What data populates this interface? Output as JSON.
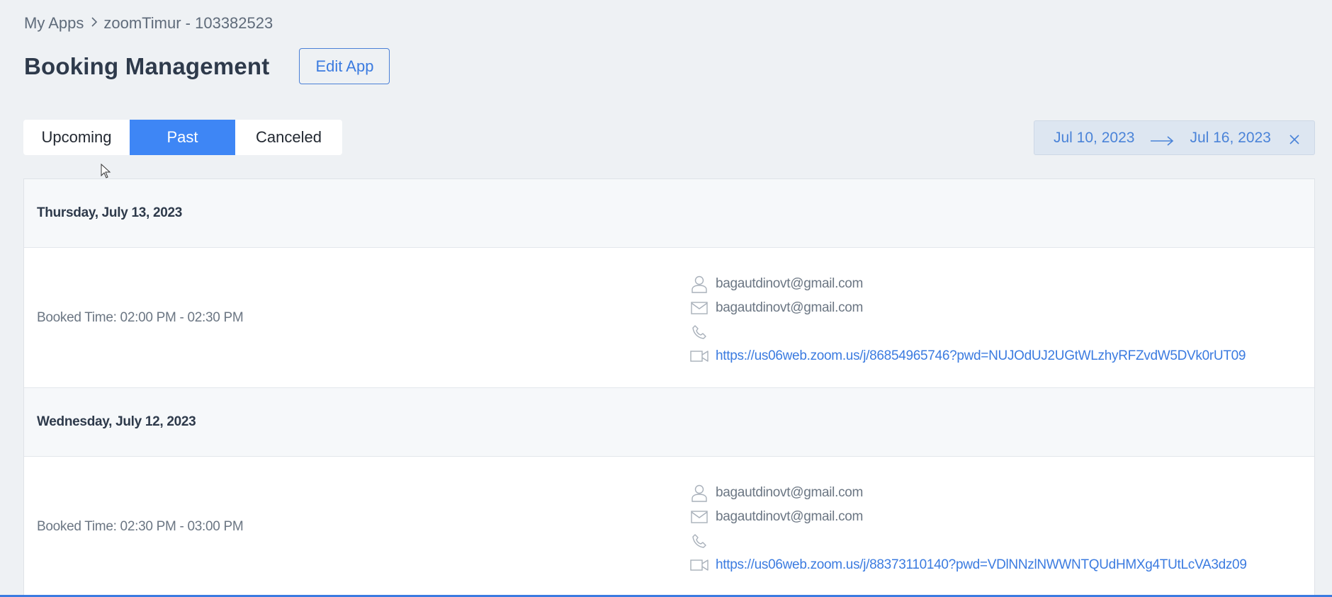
{
  "breadcrumb": {
    "root": "My Apps",
    "current": "zoomTimur - 103382523"
  },
  "header": {
    "title": "Booking Management",
    "edit_label": "Edit App"
  },
  "tabs": [
    {
      "label": "Upcoming",
      "active": false
    },
    {
      "label": "Past",
      "active": true
    },
    {
      "label": "Canceled",
      "active": false
    }
  ],
  "date_range": {
    "from": "Jul 10, 2023",
    "to": "Jul 16, 2023"
  },
  "days": [
    {
      "date": "Thursday, July 13, 2023",
      "booking": {
        "time": "Booked Time: 02:00 PM - 02:30 PM",
        "name": "bagautdinovt@gmail.com",
        "email": "bagautdinovt@gmail.com",
        "phone": "",
        "meeting_url": "https://us06web.zoom.us/j/86854965746?pwd=NUJOdUJ2UGtWLzhyRFZvdW5DVk0rUT09"
      }
    },
    {
      "date": "Wednesday, July 12, 2023",
      "booking": {
        "time": "Booked Time: 02:30 PM - 03:00 PM",
        "name": "bagautdinovt@gmail.com",
        "email": "bagautdinovt@gmail.com",
        "phone": "",
        "meeting_url": "https://us06web.zoom.us/j/88373110140?pwd=VDlNNzlNWWNTQUdHMXg4TUtLcVA3dz09"
      }
    }
  ],
  "colors": {
    "accent": "#3e86f5",
    "link": "#3b7be0",
    "background": "#eef1f4"
  }
}
